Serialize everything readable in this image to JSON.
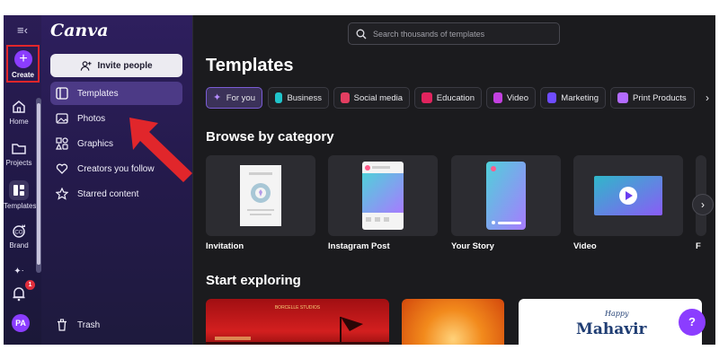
{
  "rail": {
    "create_label": "Create",
    "items": [
      {
        "label": "Home"
      },
      {
        "label": "Projects"
      },
      {
        "label": "Templates"
      },
      {
        "label": "Brand"
      }
    ],
    "notification_count": "1",
    "avatar_initials": "PA"
  },
  "panel": {
    "logo": "Canva",
    "invite_label": "Invite people",
    "nav": [
      {
        "label": "Templates"
      },
      {
        "label": "Photos"
      },
      {
        "label": "Graphics"
      },
      {
        "label": "Creators you follow"
      },
      {
        "label": "Starred content"
      }
    ],
    "trash_label": "Trash"
  },
  "main": {
    "search_placeholder": "Search thousands of templates",
    "title": "Templates",
    "chips": [
      {
        "label": "For you",
        "color": "#8b3dff"
      },
      {
        "label": "Business",
        "color": "#20c4cb"
      },
      {
        "label": "Social media",
        "color": "#e33e61"
      },
      {
        "label": "Education",
        "color": "#e0245e"
      },
      {
        "label": "Video",
        "color": "#c341e0"
      },
      {
        "label": "Marketing",
        "color": "#6f4cff"
      },
      {
        "label": "Print Products",
        "color": "#b36bff"
      }
    ],
    "browse_title": "Browse by category",
    "categories": [
      {
        "label": "Invitation"
      },
      {
        "label": "Instagram Post"
      },
      {
        "label": "Your Story"
      },
      {
        "label": "Video"
      },
      {
        "label": "F"
      }
    ],
    "explore_title": "Start exploring",
    "explore_cards": [
      {
        "text": "BORCELLE STUDIOS"
      },
      {
        "text": ""
      },
      {
        "text_small": "Happy",
        "text_big": "Mahavir"
      }
    ],
    "help_label": "?"
  }
}
